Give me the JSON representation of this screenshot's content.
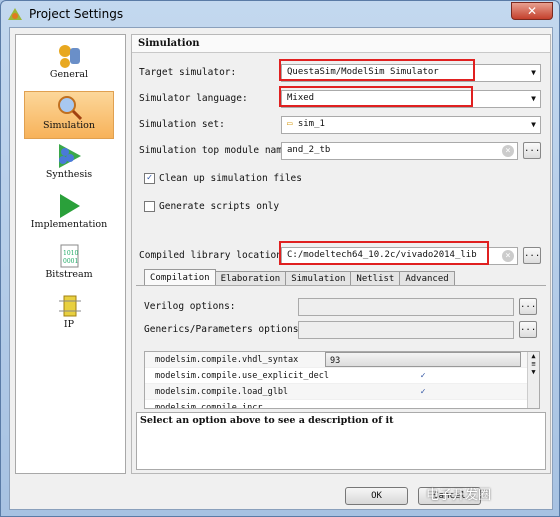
{
  "window": {
    "title": "Project Settings",
    "close": "✕"
  },
  "nav": [
    {
      "label": "General",
      "icon": "general-icon"
    },
    {
      "label": "Simulation",
      "icon": "simulation-icon",
      "selected": true
    },
    {
      "label": "Synthesis",
      "icon": "synthesis-icon"
    },
    {
      "label": "Implementation",
      "icon": "implementation-icon"
    },
    {
      "label": "Bitstream",
      "icon": "bitstream-icon"
    },
    {
      "label": "IP",
      "icon": "ip-icon"
    }
  ],
  "panel": {
    "title": "Simulation",
    "target_label": "Target simulator:",
    "target_value": "QuestaSim/ModelSim Simulator",
    "lang_label": "Simulator language:",
    "lang_value": "Mixed",
    "set_label": "Simulation set:",
    "set_value": "sim_1",
    "top_label": "Simulation top module name:",
    "top_value": "and_2_tb",
    "cleanup_label": "Clean up simulation files",
    "cleanup_checked": true,
    "gen_label": "Generate scripts only",
    "gen_checked": false,
    "lib_label": "Compiled library location:",
    "lib_value": "C:/modeltech64_10.2c/vivado2014_lib",
    "browse": "...",
    "tabs": [
      "Compilation",
      "Elaboration",
      "Simulation",
      "Netlist",
      "Advanced"
    ],
    "verilog_label": "Verilog options:",
    "generics_label": "Generics/Parameters options:",
    "rows": [
      {
        "key": "modelsim.compile.vhdl_syntax",
        "value": "93"
      },
      {
        "key": "modelsim.compile.use_explicit_decl",
        "value": "✓"
      },
      {
        "key": "modelsim.compile.load_glbl",
        "value": "✓"
      },
      {
        "key": "modelsim.compile.incr...",
        "value": ""
      }
    ],
    "description": "Select an option above to see a description of it"
  },
  "buttons": {
    "ok": "OK",
    "cancel": "Cancel"
  },
  "watermark": "电子开发圈",
  "colors": {
    "highlight": "#e02020",
    "selected": "#f7b25a"
  }
}
